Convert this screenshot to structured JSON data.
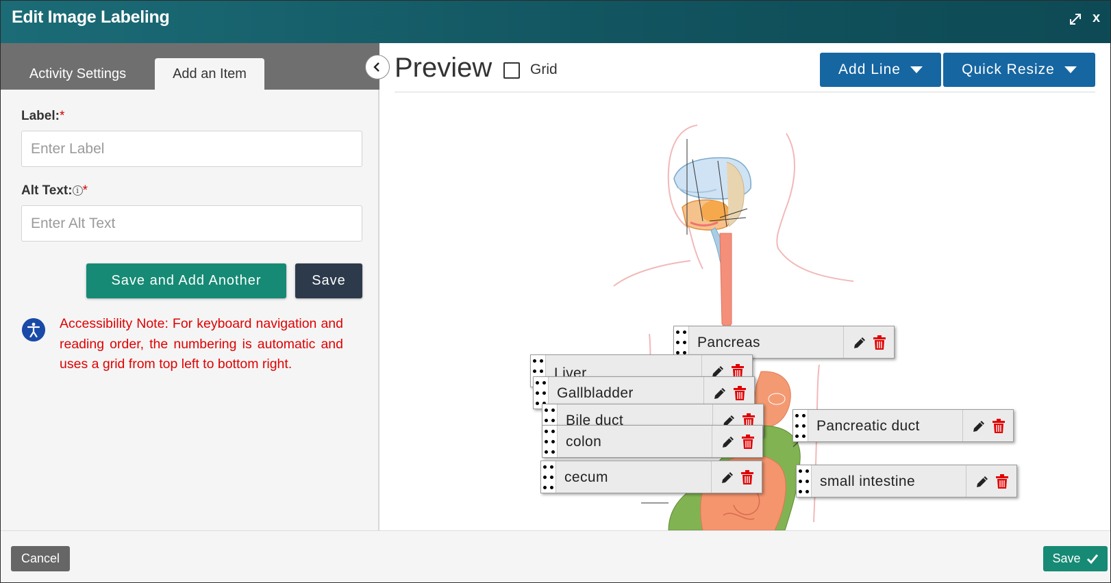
{
  "window": {
    "title": "Edit Image Labeling",
    "expand_icon": "expand-icon",
    "close_label": "x"
  },
  "sidebar": {
    "tabs": [
      {
        "label": "Activity Settings",
        "active": false
      },
      {
        "label": "Add an Item",
        "active": true
      }
    ],
    "collapse_icon": "chevron-left-icon",
    "label_field": {
      "label": "Label:",
      "required_mark": "*",
      "placeholder": "Enter Label",
      "value": ""
    },
    "alt_field": {
      "label": "Alt Text:",
      "info_glyph": "i",
      "required_mark": "*",
      "placeholder": "Enter Alt Text",
      "value": ""
    },
    "save_another_label": "Save and Add Another",
    "save_label": "Save",
    "accessibility_icon": "accessibility-icon",
    "accessibility_note": "Accessibility Note: For keyboard navigation and reading order, the numbering is automatic and uses a grid from top left to bottom right."
  },
  "preview": {
    "title": "Preview",
    "grid_label": "Grid",
    "grid_checked": false,
    "add_line_label": "Add Line",
    "quick_resize_label": "Quick Resize",
    "image_subject": "digestive-system-diagram",
    "labels": [
      {
        "text": "Pancreas"
      },
      {
        "text": "Liver"
      },
      {
        "text": "Gallbladder"
      },
      {
        "text": "Bile duct"
      },
      {
        "text": "colon"
      },
      {
        "text": "Pancreatic duct"
      },
      {
        "text": "cecum"
      },
      {
        "text": "small intestine"
      }
    ],
    "label_icons": {
      "drag": "drag-handle-icon",
      "edit": "pencil-icon",
      "delete": "trash-icon"
    }
  },
  "footer": {
    "cancel_label": "Cancel",
    "save_label": "Save",
    "save_icon": "checkmark-icon"
  },
  "colors": {
    "titlebar": "#11535e",
    "primary_green": "#168a74",
    "dark_button": "#2c3a4b",
    "blue_button": "#1666a2",
    "warning_text": "#e00000",
    "delete_red": "#e00000"
  }
}
